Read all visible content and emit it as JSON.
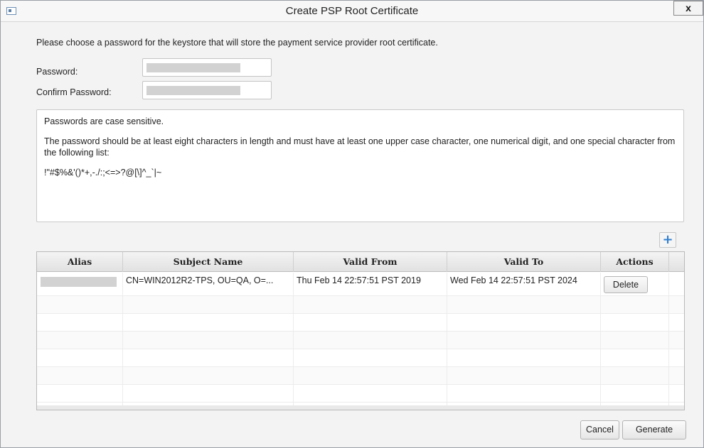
{
  "window": {
    "title": "Create PSP Root Certificate",
    "close_label": "x"
  },
  "intro_text": "Please choose a password for the keystore that will store the payment service provider root certificate.",
  "form": {
    "password_label": "Password:",
    "confirm_label": "Confirm Password:"
  },
  "info": {
    "line1": "Passwords are case sensitive.",
    "line2": "The password should be at least eight characters in length and must have at least one upper case character, one numerical digit, and one special character from the following list:",
    "line3": "!\"#$%&'()*+,-./:;<=>?@[\\]^_`|~"
  },
  "table": {
    "add_label": "+",
    "columns": [
      "Alias",
      "Subject Name",
      "Valid From",
      "Valid To",
      "Actions"
    ],
    "rows": [
      {
        "alias": "",
        "subject": "CN=WIN2012R2-TPS, OU=QA, O=...",
        "valid_from": "Thu Feb 14 22:57:51 PST 2019",
        "valid_to": "Wed Feb 14 22:57:51 PST 2024",
        "action": "Delete"
      }
    ]
  },
  "footer": {
    "cancel_label": "Cancel",
    "generate_label": "Generate"
  }
}
